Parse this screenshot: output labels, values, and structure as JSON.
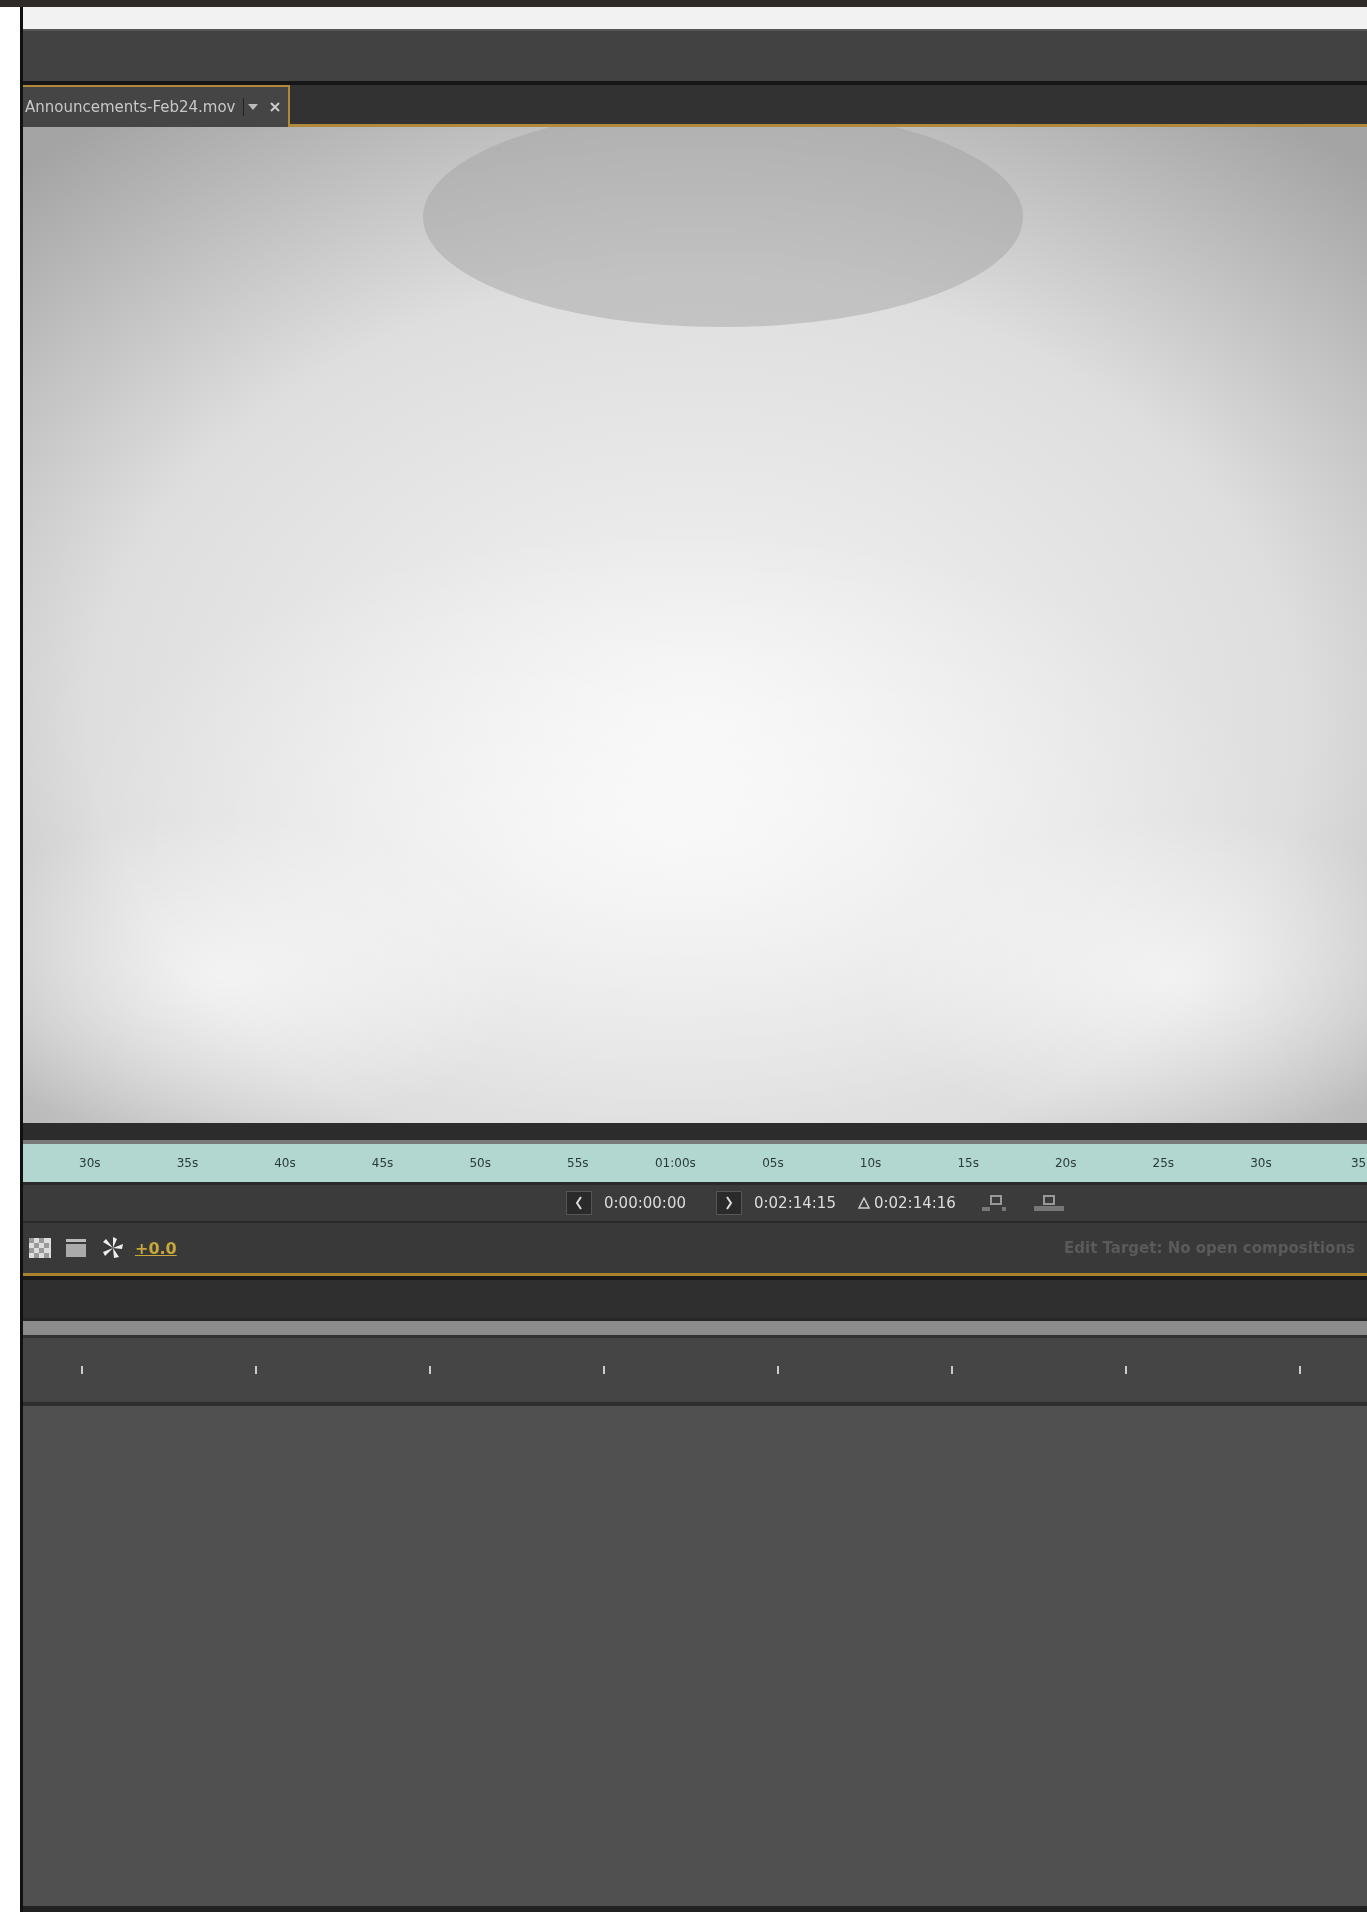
{
  "footage_panel": {
    "tab": {
      "title": "Announcements-Feb24.mov",
      "selected": true
    },
    "ruler": [
      "30s",
      "35s",
      "40s",
      "45s",
      "50s",
      "55s",
      "01:00s",
      "05s",
      "10s",
      "15s",
      "20s",
      "25s",
      "30s",
      "35"
    ],
    "in_point": "0:00:00:00",
    "out_point": "0:02:14:15",
    "duration": "0:02:14:16",
    "exposure": "+0.0",
    "edit_target": "Edit Target: No open compositions"
  }
}
